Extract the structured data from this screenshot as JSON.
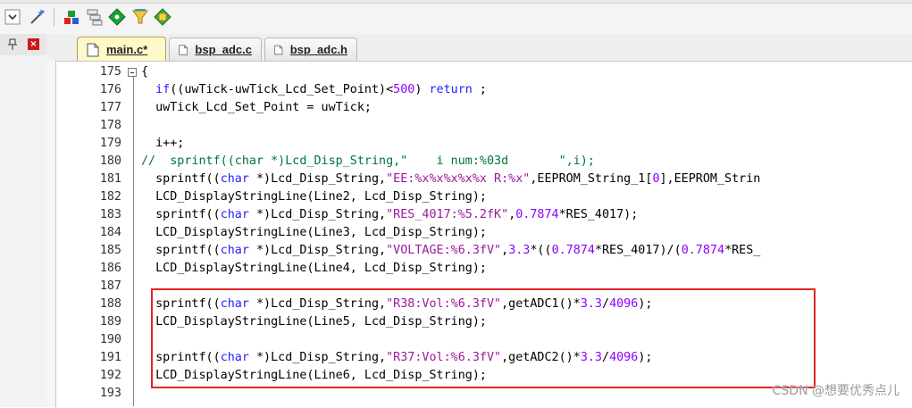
{
  "tabs": [
    {
      "label": "main.c*",
      "active": true
    },
    {
      "label": "bsp_adc.c",
      "active": false
    },
    {
      "label": "bsp_adc.h",
      "active": false
    }
  ],
  "toolbar_icons": [
    "checkbox-dropdown-icon",
    "magic-wand-icon",
    "build-target-icon",
    "batch-build-icon",
    "diamond-green-icon",
    "funnel-icon",
    "manage-components-icon"
  ],
  "pane": {
    "close_glyph": "×"
  },
  "lines": [
    {
      "n": "175",
      "code": "{"
    },
    {
      "n": "176",
      "code": "  if((uwTick-uwTick_Lcd_Set_Point)<500) return ;"
    },
    {
      "n": "177",
      "code": "  uwTick_Lcd_Set_Point = uwTick;"
    },
    {
      "n": "178",
      "code": ""
    },
    {
      "n": "179",
      "code": "  i++;"
    },
    {
      "n": "180",
      "code": "//  sprintf((char *)Lcd_Disp_String,\"    i num:%03d       \",i);"
    },
    {
      "n": "181",
      "code": "  sprintf((char *)Lcd_Disp_String,\"EE:%x%x%x%x%x R:%x\",EEPROM_String_1[0],EEPROM_Strin"
    },
    {
      "n": "182",
      "code": "  LCD_DisplayStringLine(Line2, Lcd_Disp_String);"
    },
    {
      "n": "183",
      "code": "  sprintf((char *)Lcd_Disp_String,\"RES_4017:%5.2fK\",0.7874*RES_4017);"
    },
    {
      "n": "184",
      "code": "  LCD_DisplayStringLine(Line3, Lcd_Disp_String);"
    },
    {
      "n": "185",
      "code": "  sprintf((char *)Lcd_Disp_String,\"VOLTAGE:%6.3fV\",3.3*((0.7874*RES_4017)/(0.7874*RES_"
    },
    {
      "n": "186",
      "code": "  LCD_DisplayStringLine(Line4, Lcd_Disp_String);"
    },
    {
      "n": "187",
      "code": ""
    },
    {
      "n": "188",
      "code": "  sprintf((char *)Lcd_Disp_String,\"R38:Vol:%6.3fV\",getADC1()*3.3/4096);"
    },
    {
      "n": "189",
      "code": "  LCD_DisplayStringLine(Line5, Lcd_Disp_String);"
    },
    {
      "n": "190",
      "code": ""
    },
    {
      "n": "191",
      "code": "  sprintf((char *)Lcd_Disp_String,\"R37:Vol:%6.3fV\",getADC2()*3.3/4096);"
    },
    {
      "n": "192",
      "code": "  LCD_DisplayStringLine(Line6, Lcd_Disp_String);"
    },
    {
      "n": "193",
      "code": ""
    }
  ],
  "watermark": "CSDN @想要优秀点儿",
  "colors": {
    "keyword": "#1f1fff",
    "string": "#9b1a9b",
    "number": "#8b00ff",
    "comment": "#00753a",
    "highlight_box": "#e02626",
    "active_tab": "#fff8c8"
  }
}
